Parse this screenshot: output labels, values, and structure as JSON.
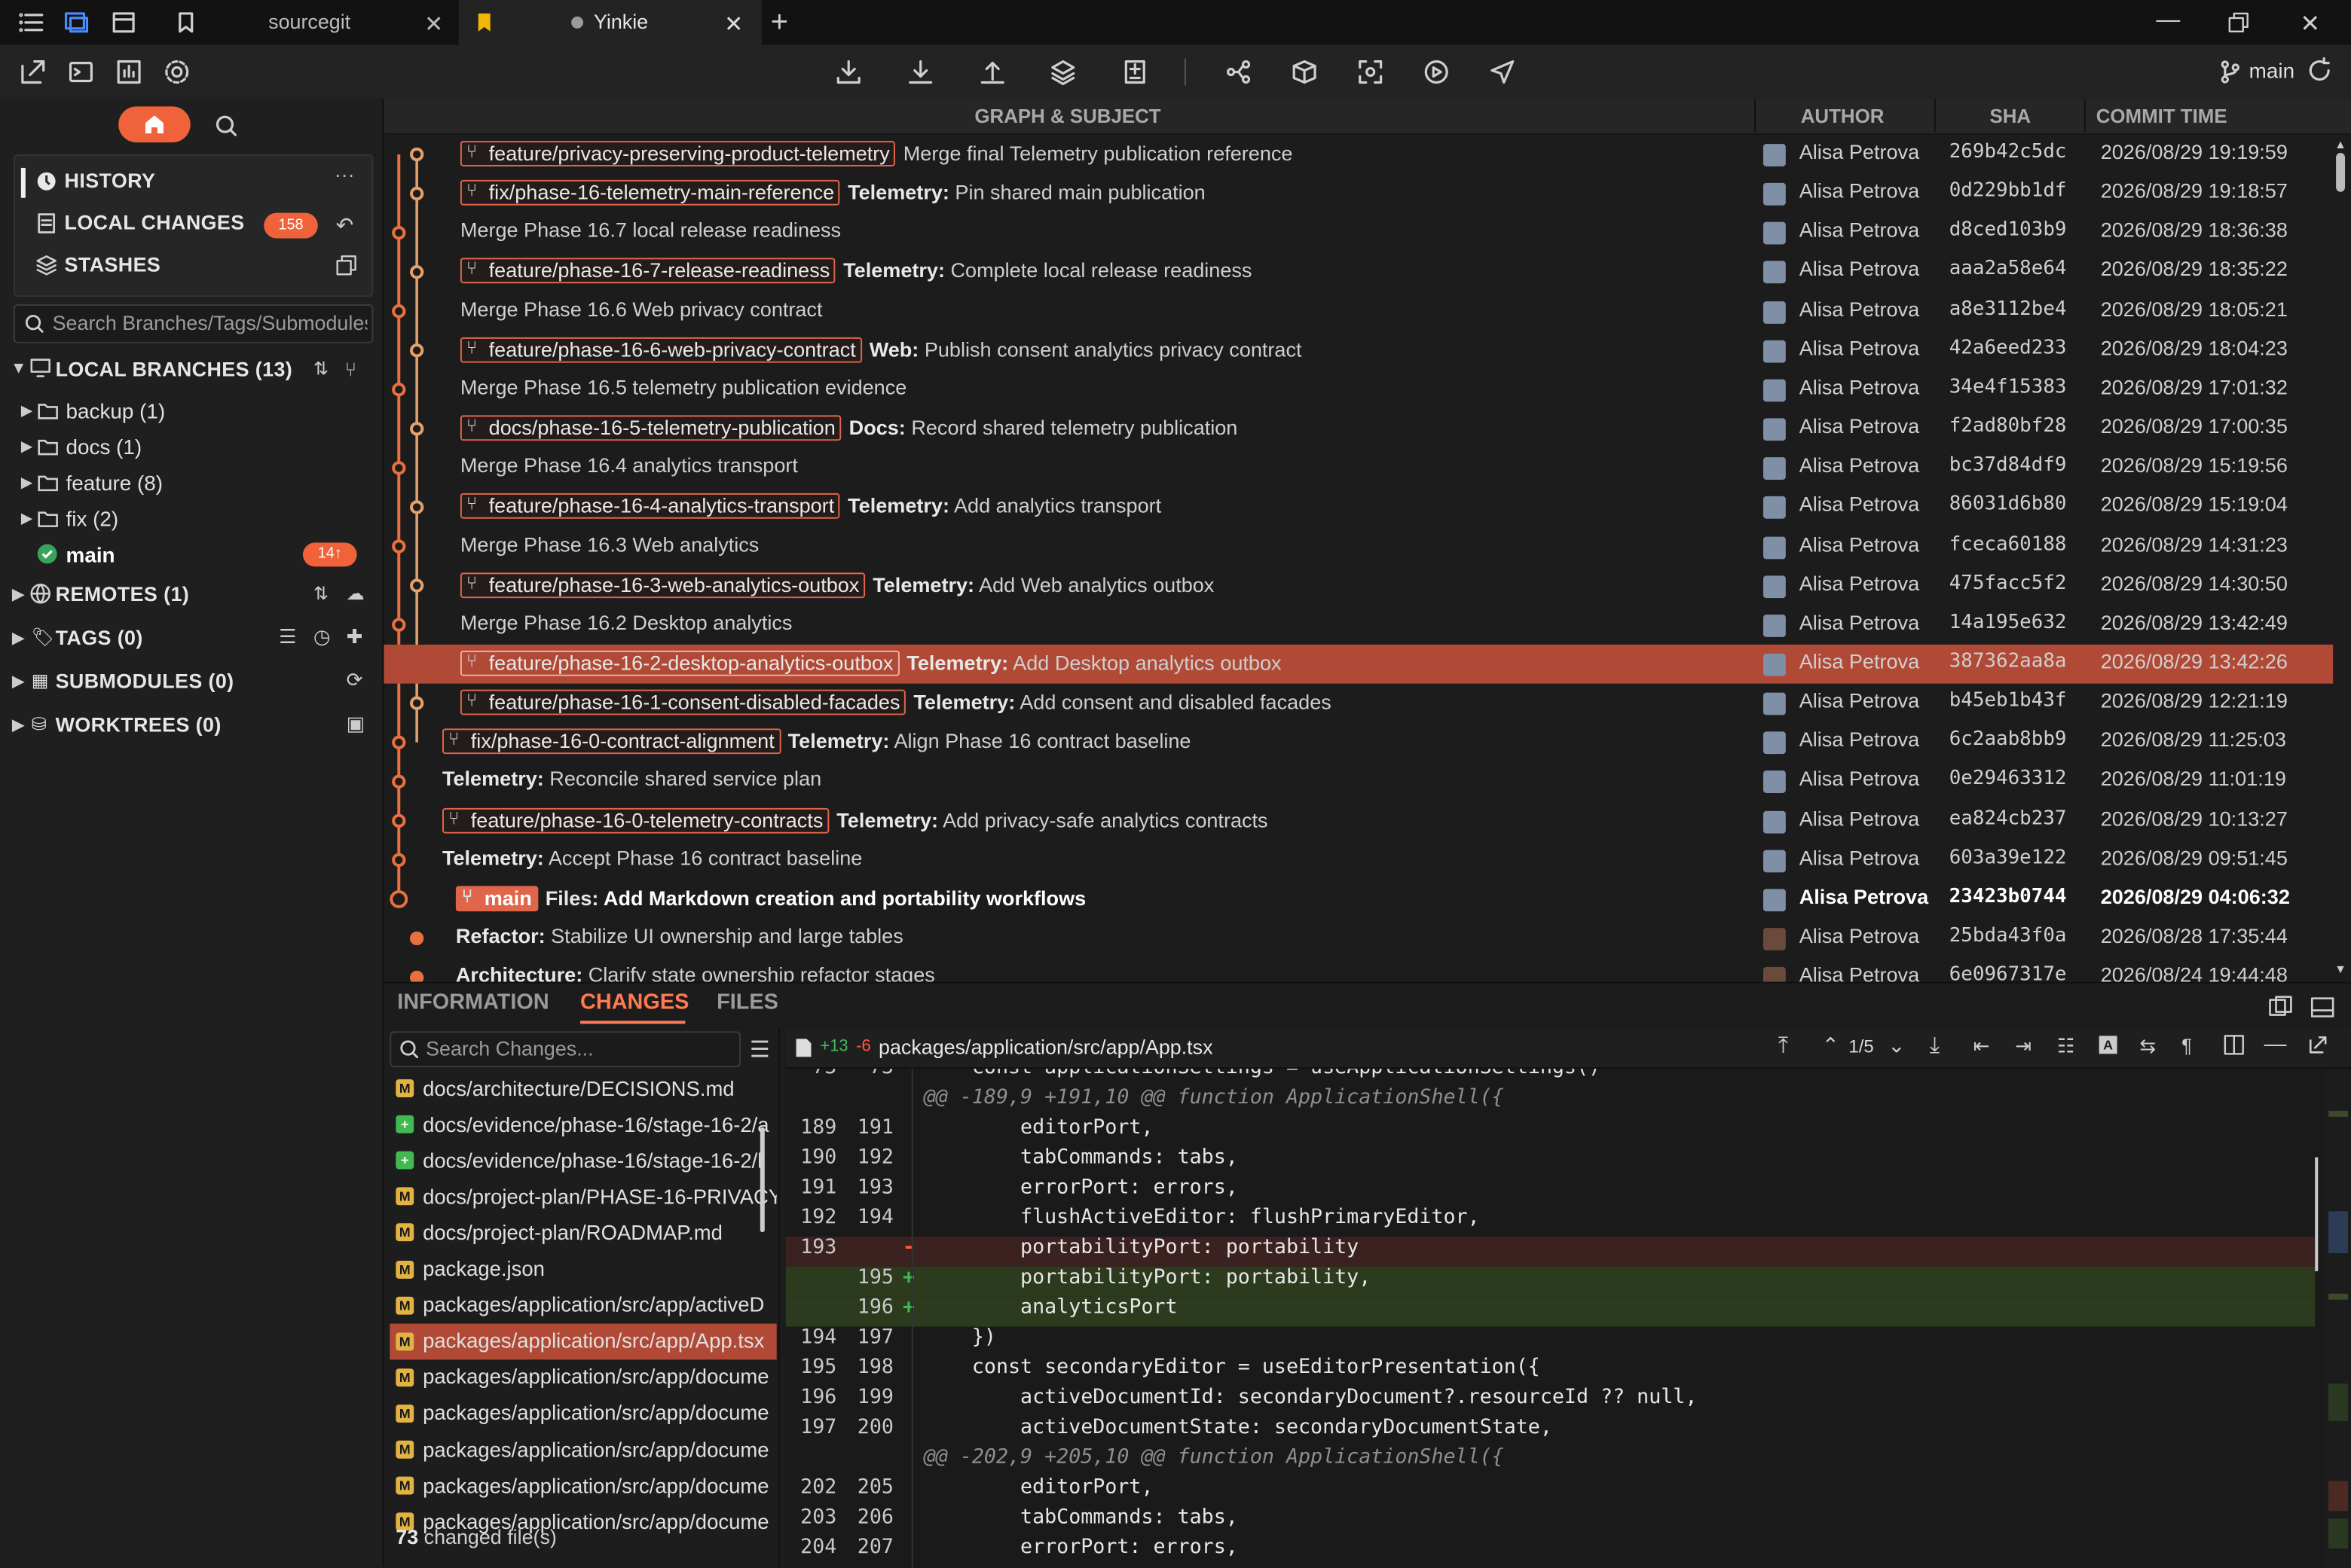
{
  "tabs": {
    "repo1": "sourcegit",
    "repo2": "Yinkie"
  },
  "toolbar": {
    "branch": "main"
  },
  "sidebar": {
    "history": "HISTORY",
    "local_changes": "LOCAL CHANGES",
    "local_changes_count": "158",
    "stashes": "STASHES",
    "search_placeholder": "Search Branches/Tags/Submodules",
    "local_branches": "LOCAL BRANCHES (13)",
    "branch_groups": [
      "backup (1)",
      "docs (1)",
      "feature (8)",
      "fix (2)"
    ],
    "main_branch": "main",
    "main_ahead": "14↑",
    "remotes": "REMOTES (1)",
    "tags": "TAGS (0)",
    "submodules": "SUBMODULES (0)",
    "worktrees": "WORKTREES (0)"
  },
  "list_header": {
    "graph": "GRAPH & SUBJECT",
    "author": "AUTHOR",
    "sha": "SHA",
    "time": "COMMIT TIME"
  },
  "commits": [
    {
      "ref": "feature/privacy-preserving-product-telemetry",
      "prefix": "",
      "text": "Merge final Telemetry publication reference",
      "author": "Alisa Petrova",
      "sha": "269b42c5dc",
      "time": "2026/08/29 19:19:59"
    },
    {
      "ref": "fix/phase-16-telemetry-main-reference",
      "prefix": "Telemetry:",
      "text": " Pin shared main publication",
      "author": "Alisa Petrova",
      "sha": "0d229bb1df",
      "time": "2026/08/29 19:18:57"
    },
    {
      "ref": "",
      "prefix": "",
      "text": "Merge Phase 16.7 local release readiness",
      "author": "Alisa Petrova",
      "sha": "d8ced103b9",
      "time": "2026/08/29 18:36:38"
    },
    {
      "ref": "feature/phase-16-7-release-readiness",
      "prefix": "Telemetry:",
      "text": " Complete local release readiness",
      "author": "Alisa Petrova",
      "sha": "aaa2a58e64",
      "time": "2026/08/29 18:35:22"
    },
    {
      "ref": "",
      "prefix": "",
      "text": "Merge Phase 16.6 Web privacy contract",
      "author": "Alisa Petrova",
      "sha": "a8e3112be4",
      "time": "2026/08/29 18:05:21"
    },
    {
      "ref": "feature/phase-16-6-web-privacy-contract",
      "prefix": "Web:",
      "text": " Publish consent analytics privacy contract",
      "author": "Alisa Petrova",
      "sha": "42a6eed233",
      "time": "2026/08/29 18:04:23"
    },
    {
      "ref": "",
      "prefix": "",
      "text": "Merge Phase 16.5 telemetry publication evidence",
      "author": "Alisa Petrova",
      "sha": "34e4f15383",
      "time": "2026/08/29 17:01:32"
    },
    {
      "ref": "docs/phase-16-5-telemetry-publication",
      "prefix": "Docs:",
      "text": " Record shared telemetry publication",
      "author": "Alisa Petrova",
      "sha": "f2ad80bf28",
      "time": "2026/08/29 17:00:35"
    },
    {
      "ref": "",
      "prefix": "",
      "text": "Merge Phase 16.4 analytics transport",
      "author": "Alisa Petrova",
      "sha": "bc37d84df9",
      "time": "2026/08/29 15:19:56"
    },
    {
      "ref": "feature/phase-16-4-analytics-transport",
      "prefix": "Telemetry:",
      "text": " Add analytics transport",
      "author": "Alisa Petrova",
      "sha": "86031d6b80",
      "time": "2026/08/29 15:19:04"
    },
    {
      "ref": "",
      "prefix": "",
      "text": "Merge Phase 16.3 Web analytics",
      "author": "Alisa Petrova",
      "sha": "fceca60188",
      "time": "2026/08/29 14:31:23"
    },
    {
      "ref": "feature/phase-16-3-web-analytics-outbox",
      "prefix": "Telemetry:",
      "text": " Add Web analytics outbox",
      "author": "Alisa Petrova",
      "sha": "475facc5f2",
      "time": "2026/08/29 14:30:50"
    },
    {
      "ref": "",
      "prefix": "",
      "text": "Merge Phase 16.2 Desktop analytics",
      "author": "Alisa Petrova",
      "sha": "14a195e632",
      "time": "2026/08/29 13:42:49"
    },
    {
      "ref": "feature/phase-16-2-desktop-analytics-outbox",
      "prefix": "Telemetry:",
      "text": " Add Desktop analytics outbox",
      "author": "Alisa Petrova",
      "sha": "387362aa8a",
      "time": "2026/08/29 13:42:26"
    },
    {
      "ref": "feature/phase-16-1-consent-disabled-facades",
      "prefix": "Telemetry:",
      "text": " Add consent and disabled facades",
      "author": "Alisa Petrova",
      "sha": "b45eb1b43f",
      "time": "2026/08/29 12:21:19"
    },
    {
      "ref": "fix/phase-16-0-contract-alignment",
      "prefix": "Telemetry:",
      "text": " Align Phase 16 contract baseline",
      "author": "Alisa Petrova",
      "sha": "6c2aab8bb9",
      "time": "2026/08/29 11:25:03"
    },
    {
      "ref": "",
      "prefix": "Telemetry:",
      "text": " Reconcile shared service plan",
      "author": "Alisa Petrova",
      "sha": "0e29463312",
      "time": "2026/08/29 11:01:19"
    },
    {
      "ref": "feature/phase-16-0-telemetry-contracts",
      "prefix": "Telemetry:",
      "text": " Add privacy-safe analytics contracts",
      "author": "Alisa Petrova",
      "sha": "ea824cb237",
      "time": "2026/08/29 10:13:27"
    },
    {
      "ref": "",
      "prefix": "Telemetry:",
      "text": " Accept Phase 16 contract baseline",
      "author": "Alisa Petrova",
      "sha": "603a39e122",
      "time": "2026/08/29 09:51:45"
    },
    {
      "ref": "main",
      "prefix": "Files:",
      "text": " Add Markdown creation and portability workflows",
      "author": "Alisa Petrova",
      "sha": "23423b0744",
      "time": "2026/08/29 04:06:32"
    },
    {
      "ref": "",
      "prefix": "Refactor:",
      "text": " Stabilize UI ownership and large tables",
      "author": "Alisa Petrova",
      "sha": "25bda43f0a",
      "time": "2026/08/28 17:35:44"
    },
    {
      "ref": "",
      "prefix": "Architecture:",
      "text": " Clarify state ownership refactor stages",
      "author": "Alisa Petrova",
      "sha": "6e0967317e",
      "time": "2026/08/24 19:44:48"
    }
  ],
  "bottom_tabs": {
    "info": "INFORMATION",
    "changes": "CHANGES",
    "files": "FILES"
  },
  "changes": {
    "search_placeholder": "Search Changes...",
    "files": [
      {
        "badge": "M",
        "path": "docs/architecture/DECISIONS.md"
      },
      {
        "badge": "+",
        "path": "docs/evidence/phase-16/stage-16-2/a"
      },
      {
        "badge": "+",
        "path": "docs/evidence/phase-16/stage-16-2/l"
      },
      {
        "badge": "M",
        "path": "docs/project-plan/PHASE-16-PRIVACY"
      },
      {
        "badge": "M",
        "path": "docs/project-plan/ROADMAP.md"
      },
      {
        "badge": "M",
        "path": "package.json"
      },
      {
        "badge": "M",
        "path": "packages/application/src/app/activeD"
      },
      {
        "badge": "M",
        "path": "packages/application/src/app/App.tsx"
      },
      {
        "badge": "M",
        "path": "packages/application/src/app/docume"
      },
      {
        "badge": "M",
        "path": "packages/application/src/app/docume"
      },
      {
        "badge": "M",
        "path": "packages/application/src/app/docume"
      },
      {
        "badge": "M",
        "path": "packages/application/src/app/docume"
      },
      {
        "badge": "M",
        "path": "packages/application/src/app/docume"
      }
    ],
    "count_num": "73",
    "count_label": " changed file(s)"
  },
  "diff": {
    "added": "+13",
    "removed": "-6",
    "path": "packages/application/src/app/App.tsx",
    "nav": "1/5",
    "lines": [
      {
        "t": "ctx",
        "o": "73",
        "n": "73",
        "c": "    const applicationSettings = useApplicationSettings()"
      },
      {
        "t": "hunk",
        "o": "",
        "n": "",
        "c": "@@ -189,9 +191,10 @@ function ApplicationShell({"
      },
      {
        "t": "ctx",
        "o": "189",
        "n": "191",
        "c": "        editorPort,"
      },
      {
        "t": "ctx",
        "o": "190",
        "n": "192",
        "c": "        tabCommands: tabs,"
      },
      {
        "t": "ctx",
        "o": "191",
        "n": "193",
        "c": "        errorPort: errors,"
      },
      {
        "t": "ctx",
        "o": "192",
        "n": "194",
        "c": "        flushActiveEditor: flushPrimaryEditor,"
      },
      {
        "t": "del",
        "o": "193",
        "n": "",
        "c": "        portabilityPort: portability"
      },
      {
        "t": "add",
        "o": "",
        "n": "195",
        "c": "        portabilityPort: portability,"
      },
      {
        "t": "add",
        "o": "",
        "n": "196",
        "c": "        analyticsPort"
      },
      {
        "t": "ctx",
        "o": "194",
        "n": "197",
        "c": "    })"
      },
      {
        "t": "ctx",
        "o": "195",
        "n": "198",
        "c": "    const secondaryEditor = useEditorPresentation({"
      },
      {
        "t": "ctx",
        "o": "196",
        "n": "199",
        "c": "        activeDocumentId: secondaryDocument?.resourceId ?? null,"
      },
      {
        "t": "ctx",
        "o": "197",
        "n": "200",
        "c": "        activeDocumentState: secondaryDocumentState,"
      },
      {
        "t": "hunk",
        "o": "",
        "n": "",
        "c": "@@ -202,9 +205,10 @@ function ApplicationShell({"
      },
      {
        "t": "ctx",
        "o": "202",
        "n": "205",
        "c": "        editorPort,"
      },
      {
        "t": "ctx",
        "o": "203",
        "n": "206",
        "c": "        tabCommands: tabs,"
      },
      {
        "t": "ctx",
        "o": "204",
        "n": "207",
        "c": "        errorPort: errors,"
      }
    ]
  },
  "colors": {
    "accent": "#ff6a3d",
    "selected_row": "#b04a36",
    "graph": "#f0a070"
  }
}
